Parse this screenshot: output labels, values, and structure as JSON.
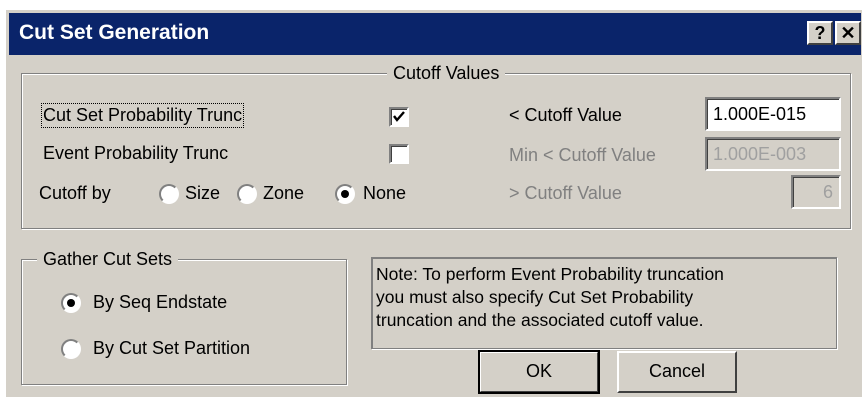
{
  "window": {
    "title": "Cut Set Generation",
    "help_button": "?",
    "close_button": "✕"
  },
  "cutoff_group": {
    "legend": "Cutoff Values",
    "cutset_prob_trunc": {
      "label": "Cut Set Probability Trunc",
      "checked": true
    },
    "event_prob_trunc": {
      "label": "Event Probability Trunc",
      "checked": false
    },
    "cutoff_by": {
      "label": "Cutoff by",
      "options": [
        {
          "label": "Size",
          "selected": false
        },
        {
          "label": "Zone",
          "selected": false
        },
        {
          "label": "None",
          "selected": true
        }
      ]
    },
    "less_cutoff": {
      "label": "< Cutoff Value",
      "value": "1.000E-015"
    },
    "min_less_cutoff": {
      "label": "Min < Cutoff Value",
      "value": "1.000E-003"
    },
    "greater_cutoff": {
      "label": "> Cutoff Value",
      "value": "6"
    }
  },
  "gather_group": {
    "legend": "Gather Cut Sets",
    "options": [
      {
        "label": "By Seq Endstate",
        "selected": true
      },
      {
        "label": "By Cut Set Partition",
        "selected": false
      }
    ]
  },
  "note": {
    "lines": [
      "Note: To perform Event Probability truncation",
      "you must also specify Cut Set Probability",
      "truncation and the associated cutoff value."
    ]
  },
  "buttons": {
    "ok": "OK",
    "cancel": "Cancel"
  }
}
